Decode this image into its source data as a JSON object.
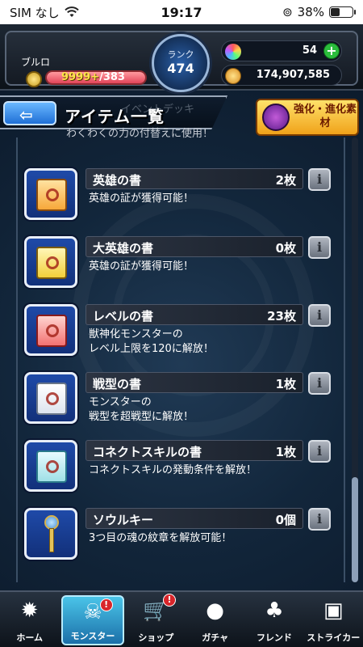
{
  "status_bar": {
    "carrier": "SIM なし",
    "time": "19:17",
    "battery": "38%"
  },
  "header": {
    "player_name": "ブルロ",
    "stamina_current": "9999+",
    "stamina_max": "/383",
    "rank_label": "ランク",
    "rank_value": "474",
    "gems": "54",
    "gold": "174,907,585"
  },
  "title_bar": {
    "back_icon": "back-arrow-icon",
    "title": "アイテム一覧",
    "underlay_text": "イベントデッキ",
    "underlay_subtext": "わくわくの力の付替えに使用！"
  },
  "upgrade_button": {
    "label": "強化・進化素材"
  },
  "items": [
    {
      "name": "英雄の書",
      "count": "2枚",
      "desc": "英雄の証が獲得可能！",
      "icon": "scroll-orange"
    },
    {
      "name": "大英雄の書",
      "count": "0枚",
      "desc": "英雄の証が獲得可能！",
      "icon": "scroll-gold"
    },
    {
      "name": "レベルの書",
      "count": "23枚",
      "desc": "獣神化モンスターの\nレベル上限を120に解放！",
      "icon": "scroll-red"
    },
    {
      "name": "戦型の書",
      "count": "1枚",
      "desc": "モンスターの\n戦型を超戦型に解放！",
      "icon": "scroll-white"
    },
    {
      "name": "コネクトスキルの書",
      "count": "1枚",
      "desc": "コネクトスキルの発動条件を解放！",
      "icon": "scroll-teal"
    },
    {
      "name": "ソウルキー",
      "count": "0個",
      "desc": "3つ目の魂の紋章を解放可能！",
      "icon": "key"
    }
  ],
  "bottom_nav": [
    {
      "label": "ホーム",
      "icon": "home-icon"
    },
    {
      "label": "モンスター",
      "icon": "monster-icon",
      "active": true,
      "badge": "!"
    },
    {
      "label": "ショップ",
      "icon": "cart-icon",
      "badge": "!"
    },
    {
      "label": "ガチャ",
      "icon": "gacha-egg-icon"
    },
    {
      "label": "フレンド",
      "icon": "friends-icon"
    },
    {
      "label": "ストライカー",
      "icon": "striker-card-icon"
    }
  ],
  "colors": {
    "accent": "#1f6fd6",
    "active_tab": "#4ac4e8",
    "badge": "#d8252a",
    "gold": "#f0a21a"
  }
}
